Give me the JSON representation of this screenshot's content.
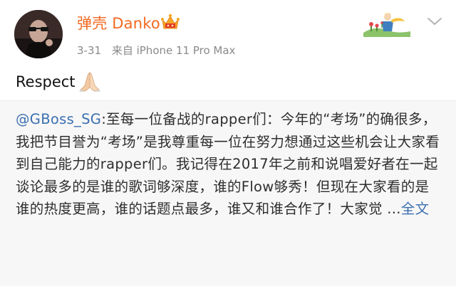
{
  "post": {
    "author": {
      "name": "弹壳 Danko",
      "avatar": "avatar",
      "badge_icon": "vip-crown-icon"
    },
    "meta": {
      "date": "3-31",
      "source": "来自 iPhone 11 Pro Max"
    },
    "text": "Respect",
    "emoji_icon": "praying-hands-icon",
    "repost": {
      "mention": "@GBoss_SG",
      "text": ":至每一位备战的rapper们：今年的“考场”的确很多，我把节目誉为“考场”是我尊重每一位在努力想通过这些机会让大家看到自己能力的rapper们。我记得在2017年之前和说唱爱好者在一起谈论最多的是谁的歌词够深度，谁的Flow够秀！但现在大家看的是谁的热度更高，谁的话题点最多，谁又和谁合作了！大家觉 ...",
      "full_text_link": "全文"
    }
  },
  "colors": {
    "author_name": "#f26a21",
    "meta": "#8a8a8a",
    "link": "#3a6fb0",
    "repost_bg": "#f7f7f7"
  }
}
